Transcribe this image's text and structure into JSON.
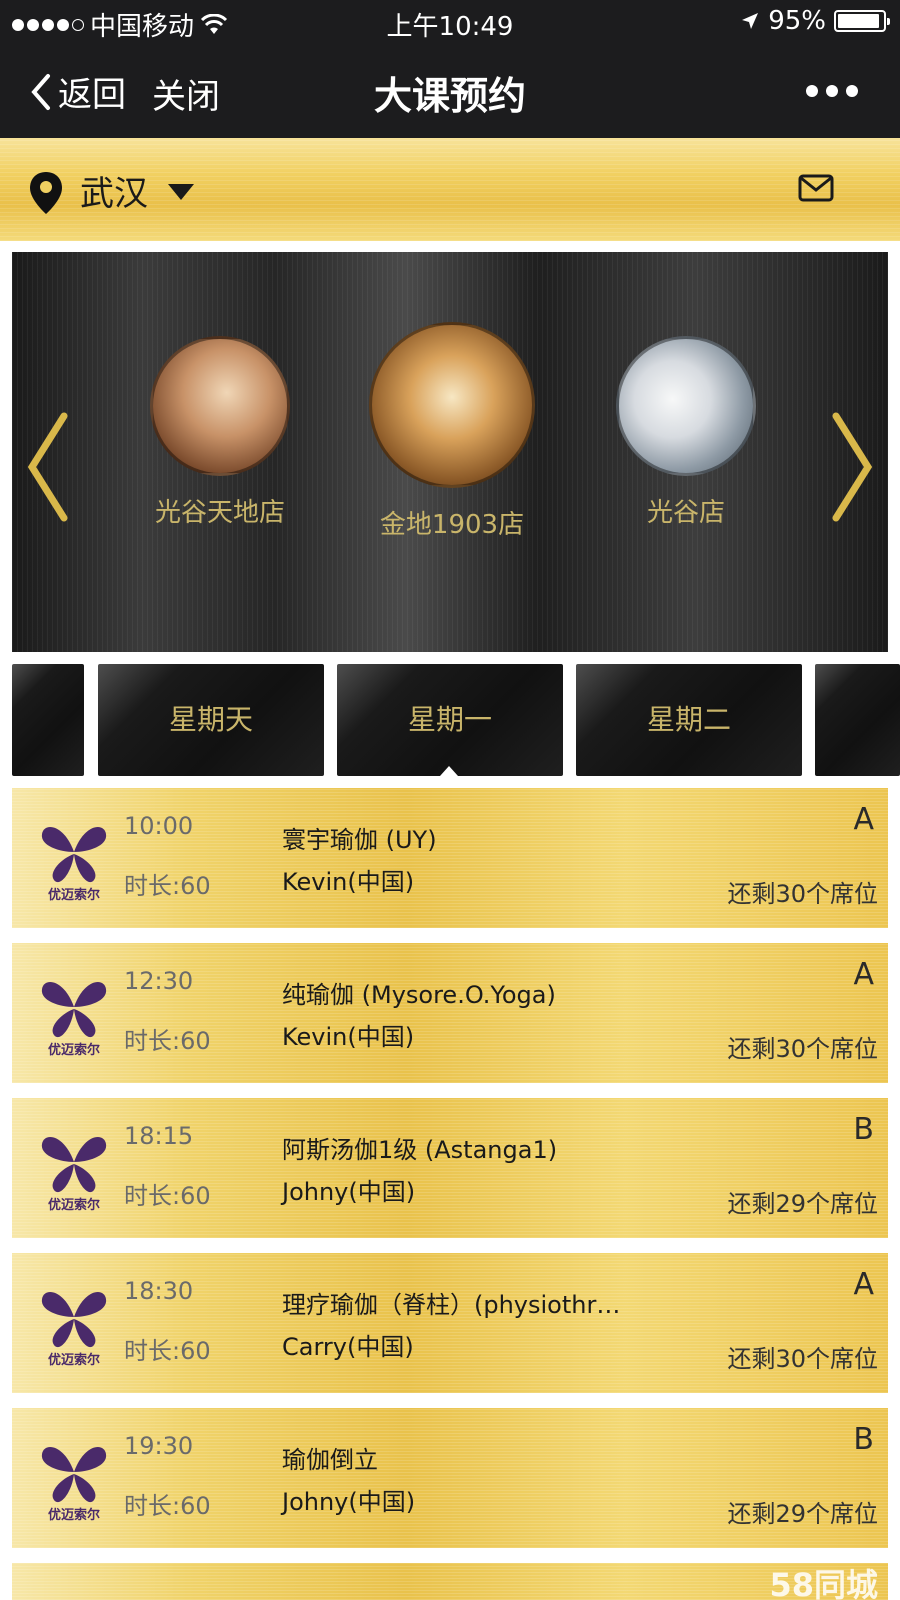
{
  "status_bar": {
    "carrier": "中国移动",
    "time": "上午10:49",
    "battery": "95%"
  },
  "nav": {
    "back_label": "返回",
    "close_label": "关闭",
    "title": "大课预约"
  },
  "city": {
    "name": "武汉"
  },
  "stores": [
    {
      "name": "光谷天地店"
    },
    {
      "name": "金地1903店"
    },
    {
      "name": "光谷店"
    }
  ],
  "day_tabs": [
    {
      "label": "星期天"
    },
    {
      "label": "星期一",
      "selected": true
    },
    {
      "label": "星期二"
    }
  ],
  "classes": [
    {
      "time": "10:00",
      "duration": "时长:60",
      "title": "寰宇瑜伽 (UY)",
      "teacher": "Kevin(中国)",
      "room": "A",
      "seats": "还剩30个席位"
    },
    {
      "time": "12:30",
      "duration": "时长:60",
      "title": "纯瑜伽 (Mysore.O.Yoga)",
      "teacher": "Kevin(中国)",
      "room": "A",
      "seats": "还剩30个席位"
    },
    {
      "time": "18:15",
      "duration": "时长:60",
      "title": "阿斯汤伽1级 (Astanga1)",
      "teacher": "Johny(中国)",
      "room": "B",
      "seats": "还剩29个席位"
    },
    {
      "time": "18:30",
      "duration": "时长:60",
      "title": "理疗瑜伽（脊柱）(physiothr…",
      "teacher": "Carry(中国)",
      "room": "A",
      "seats": "还剩30个席位"
    },
    {
      "time": "19:30",
      "duration": "时长:60",
      "title": "瑜伽倒立",
      "teacher": "Johny(中国)",
      "room": "B",
      "seats": "还剩29个席位"
    }
  ],
  "logo_text": "优迈索尔",
  "watermark": "58同城",
  "colors": {
    "accent_gold": "#e9c24b",
    "dark_bar": "#1c1c1e",
    "store_name": "#c9b56a",
    "logo_purple": "#4a2a6a"
  }
}
